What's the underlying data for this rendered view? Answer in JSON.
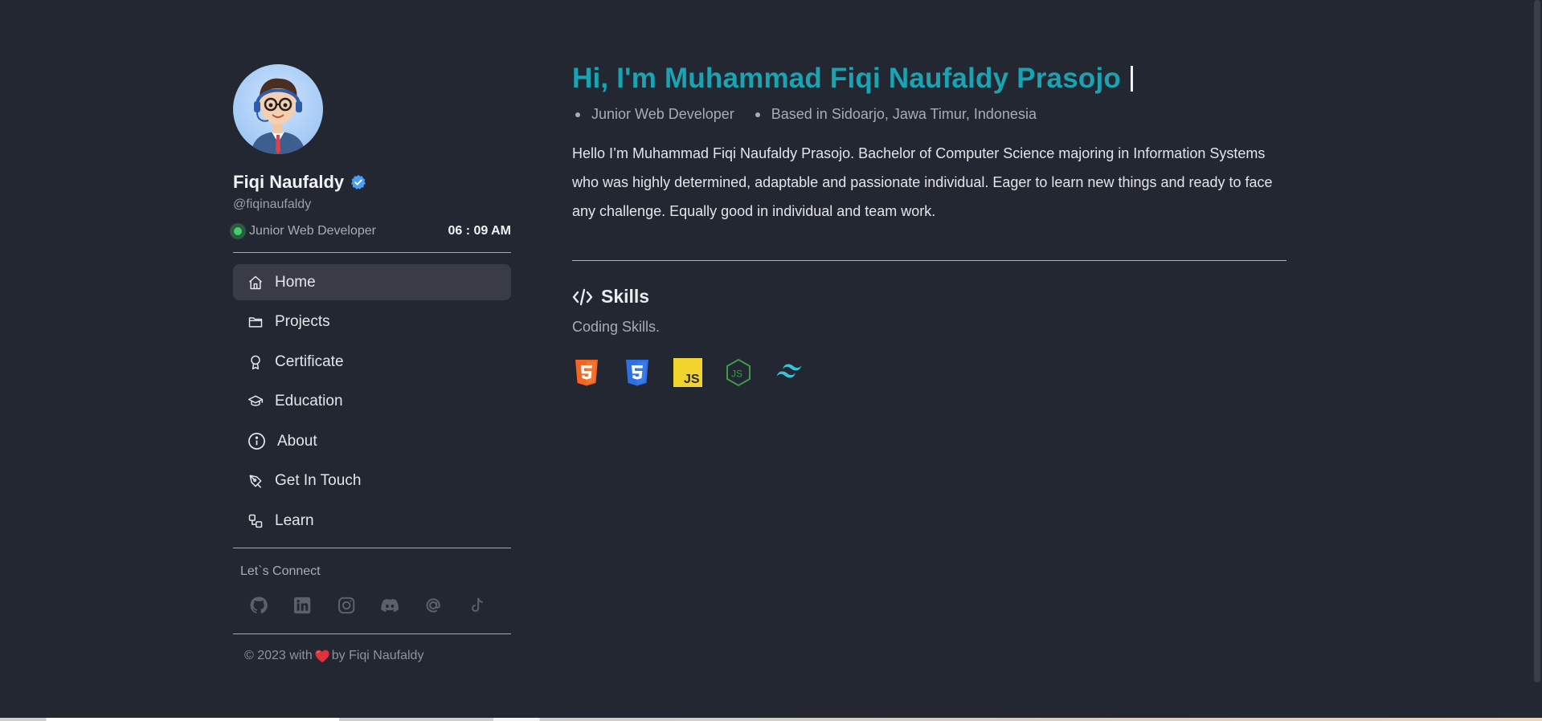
{
  "profile": {
    "name": "Fiqi Naufaldy",
    "handle": "@fiqinaufaldy",
    "role": "Junior Web Developer",
    "clock": "06 : 09 AM"
  },
  "nav": {
    "items": [
      {
        "label": "Home",
        "icon": "home-icon",
        "active": true
      },
      {
        "label": "Projects",
        "icon": "folder-icon",
        "active": false
      },
      {
        "label": "Certificate",
        "icon": "award-icon",
        "active": false
      },
      {
        "label": "Education",
        "icon": "graduation-cap-icon",
        "active": false
      },
      {
        "label": "About",
        "icon": "info-icon",
        "active": false
      },
      {
        "label": "Get In Touch",
        "icon": "pen-tool-icon",
        "active": false
      },
      {
        "label": "Learn",
        "icon": "shapes-icon",
        "active": false
      }
    ]
  },
  "connect": {
    "title": "Let`s Connect",
    "icons": [
      "github-icon",
      "linkedin-icon",
      "instagram-icon",
      "discord-icon",
      "at-icon",
      "tiktok-icon"
    ]
  },
  "footer": {
    "prefix": "© 2023 with",
    "suffix": "by Fiqi Naufaldy"
  },
  "hero": {
    "headline": "Hi, I'm Muhammad Fiqi Naufaldy Prasojo",
    "meta": [
      "Junior Web Developer",
      "Based in Sidoarjo, Jawa Timur, Indonesia"
    ],
    "intro": "Hello I’m Muhammad Fiqi Naufaldy Prasojo. Bachelor of Computer Science majoring in Information Systems who was highly determined, adaptable and passionate individual. Eager to learn new things and ready to face any challenge. Equally good in individual and team work."
  },
  "skills": {
    "title": "Skills",
    "subtitle": "Coding Skills.",
    "icons": [
      "html5-icon",
      "css3-icon",
      "javascript-icon",
      "nodejs-icon",
      "tailwind-icon"
    ]
  },
  "colors": {
    "background": "#222731",
    "accent": "#1aa3b2",
    "active_nav": "#393c46",
    "status_green": "#3ecf6a",
    "verified_blue": "#4a9ff5"
  }
}
